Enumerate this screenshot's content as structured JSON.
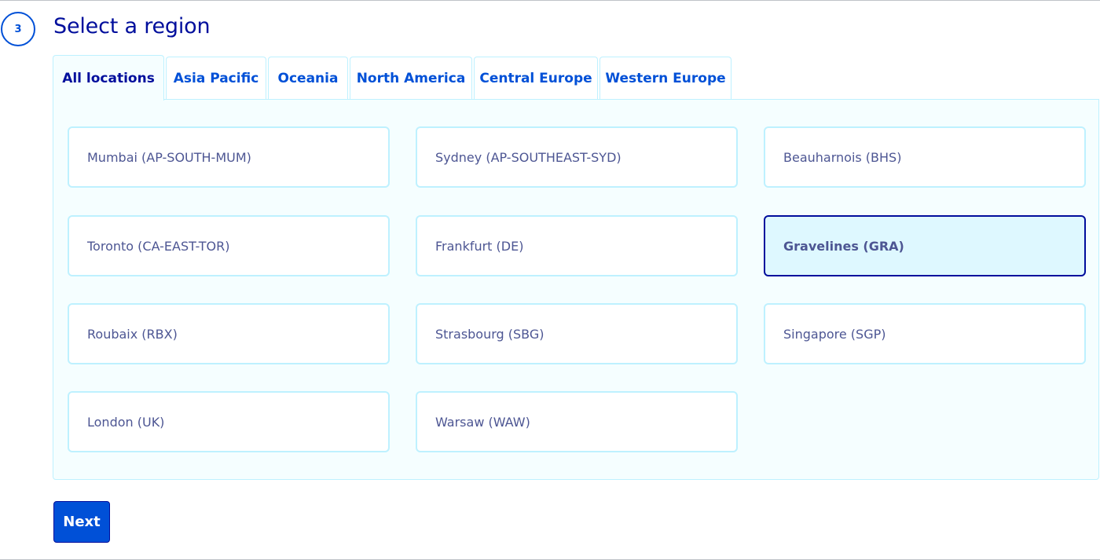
{
  "step": {
    "number": "3",
    "title": "Select a region"
  },
  "tabs": [
    {
      "label": "All locations",
      "active": true
    },
    {
      "label": "Asia Pacific",
      "active": false
    },
    {
      "label": "Oceania",
      "active": false
    },
    {
      "label": "North America",
      "active": false
    },
    {
      "label": "Central Europe",
      "active": false
    },
    {
      "label": "Western Europe",
      "active": false
    }
  ],
  "regions": [
    {
      "label": "Mumbai (AP-SOUTH-MUM)",
      "selected": false
    },
    {
      "label": "Sydney (AP-SOUTHEAST-SYD)",
      "selected": false
    },
    {
      "label": "Beauharnois (BHS)",
      "selected": false
    },
    {
      "label": "Toronto (CA-EAST-TOR)",
      "selected": false
    },
    {
      "label": "Frankfurt (DE)",
      "selected": false
    },
    {
      "label": "Gravelines (GRA)",
      "selected": true
    },
    {
      "label": "Roubaix (RBX)",
      "selected": false
    },
    {
      "label": "Strasbourg (SBG)",
      "selected": false
    },
    {
      "label": "Singapore (SGP)",
      "selected": false
    },
    {
      "label": "London (UK)",
      "selected": false
    },
    {
      "label": "Warsaw (WAW)",
      "selected": false
    }
  ],
  "actions": {
    "next_label": "Next"
  },
  "colors": {
    "primary": "#0050d7",
    "heading": "#000e9c",
    "card_border": "#bef1ff",
    "panel_bg": "#f5feff",
    "selected_bg": "#def8ff",
    "card_text": "#4d5693"
  }
}
